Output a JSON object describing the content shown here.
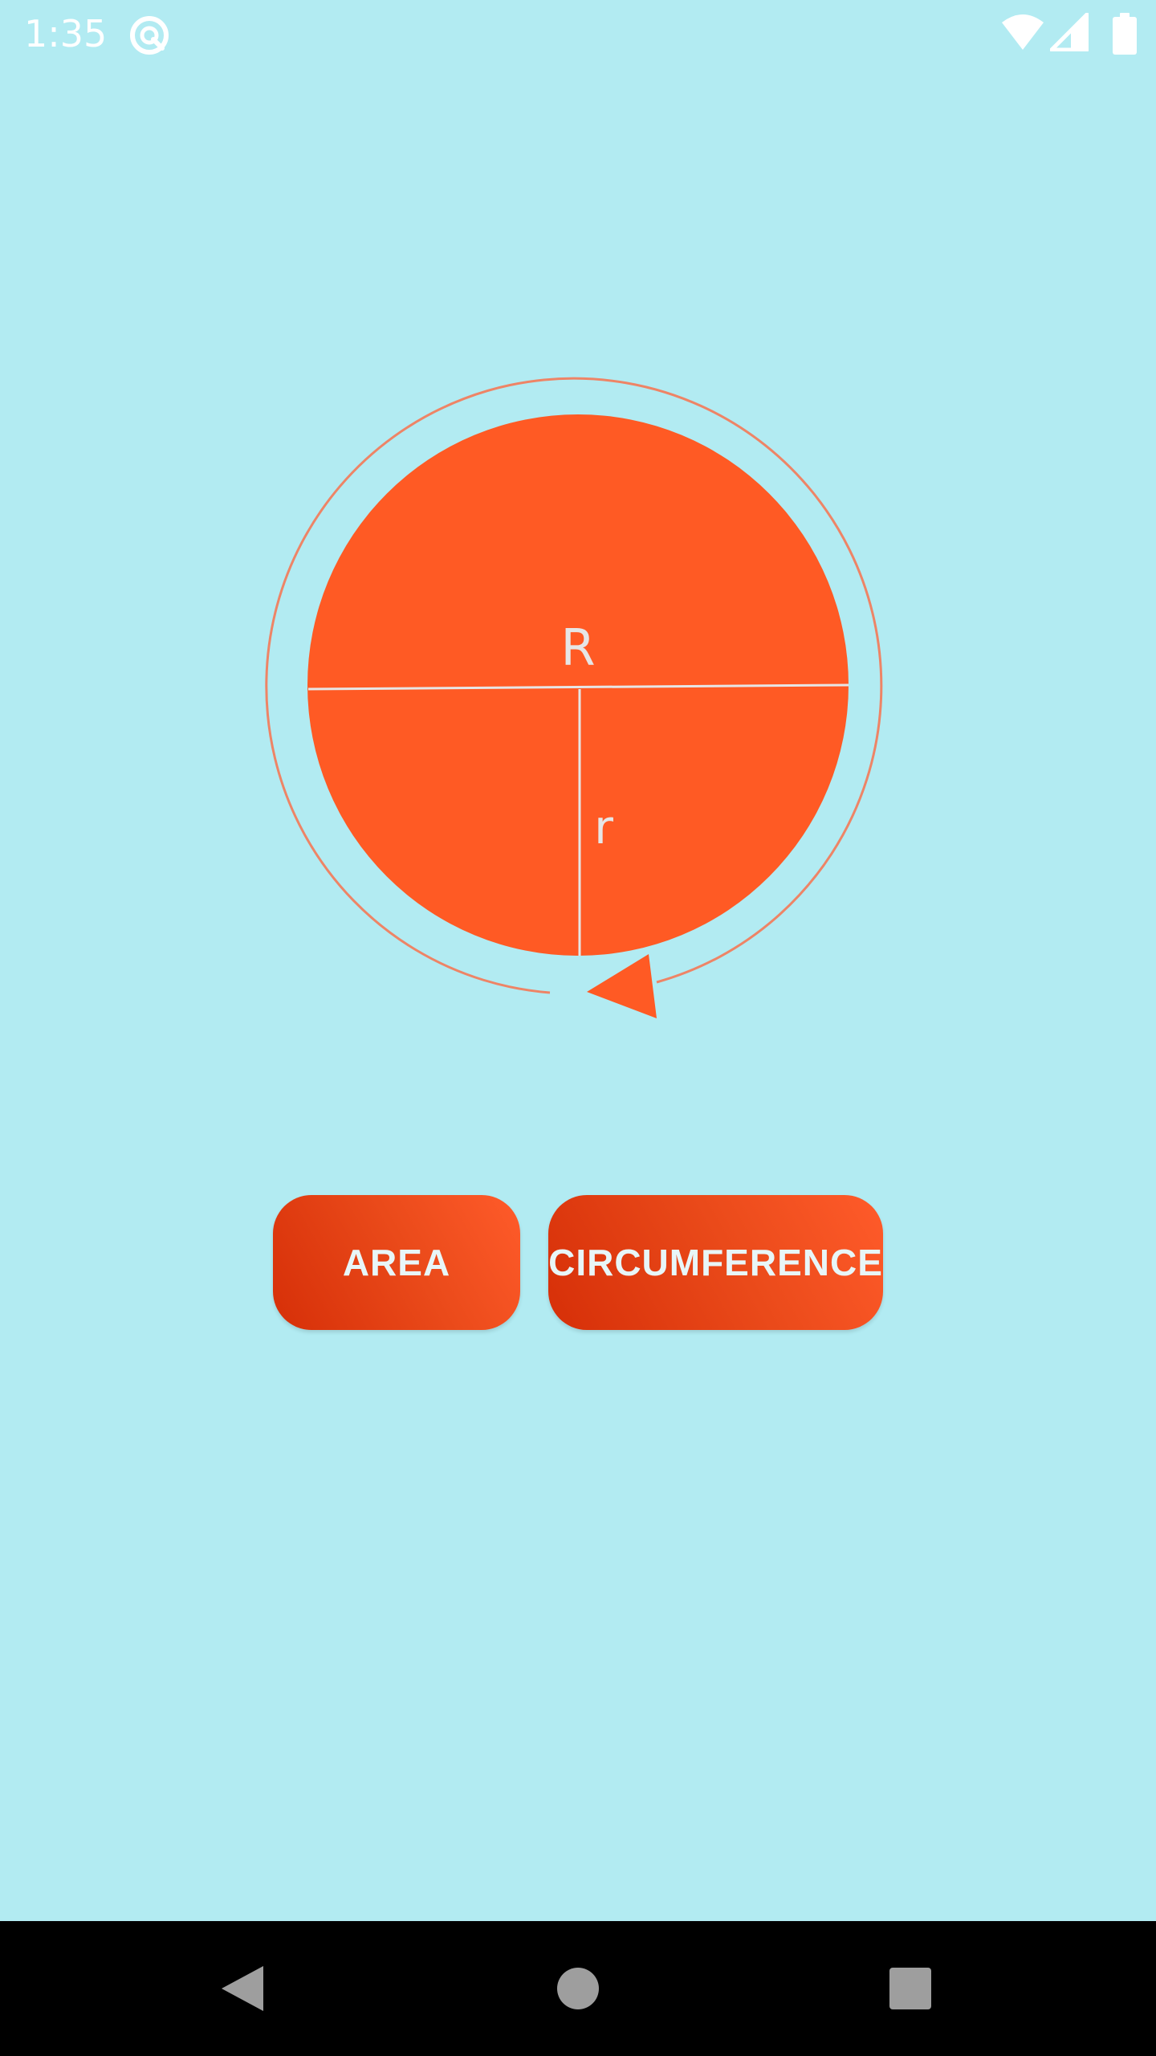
{
  "status_bar": {
    "time": "1:35",
    "app_icon": "app-notification-icon",
    "icons": [
      "wifi-icon",
      "cell-signal-icon",
      "battery-icon"
    ]
  },
  "diagram": {
    "big_radius_label": "R",
    "small_radius_label": "r",
    "circle_color": "#ff5a24",
    "outline_color": "#ee8466",
    "line_color": "#e6e6e6"
  },
  "buttons": {
    "area_label": "AREA",
    "circumference_label": "CIRCUMFERENCE"
  },
  "colors": {
    "background": "#b2ebf2",
    "button_gradient_start": "#d62f08",
    "button_gradient_end": "#ff5b2a",
    "button_text": "#e8f6f8",
    "nav_bar": "#000000"
  },
  "nav_bar": {
    "icons": [
      "back-icon",
      "home-icon",
      "recent-apps-icon"
    ]
  }
}
